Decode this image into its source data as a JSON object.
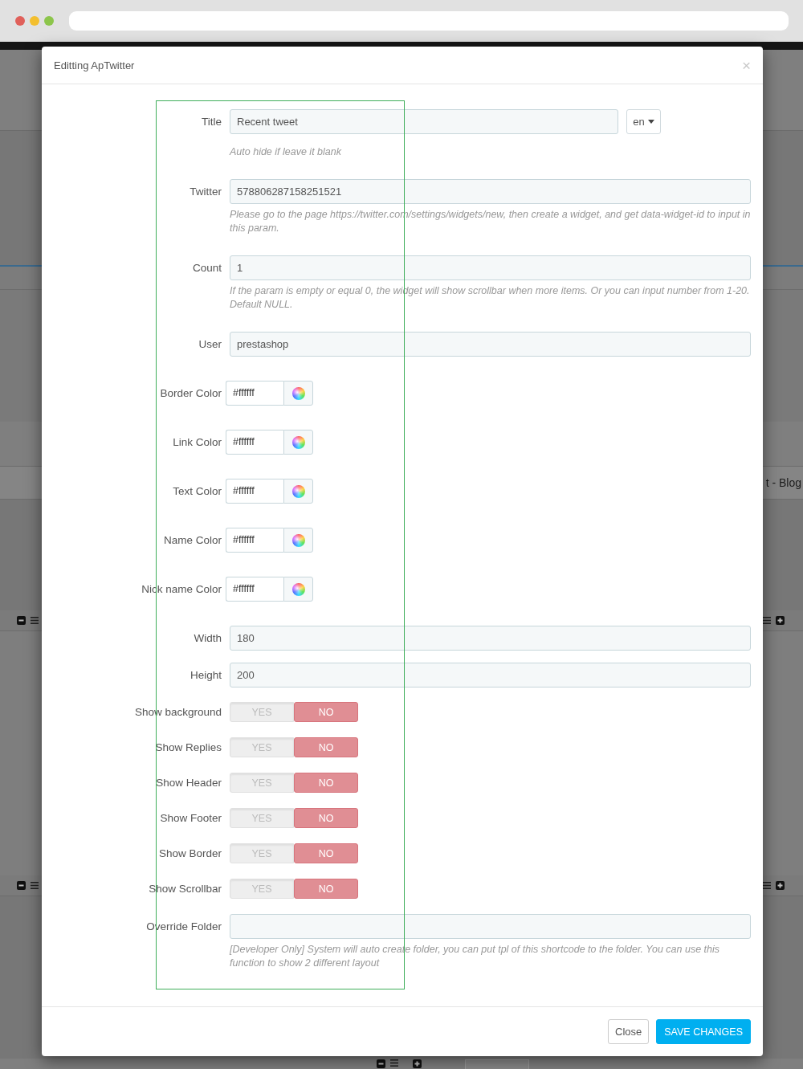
{
  "background_page": {
    "text": "t - Blog"
  },
  "modal": {
    "title": "Editting ApTwitter",
    "close": "×",
    "fields": [
      {
        "kind": "text",
        "label": "Title",
        "value": "Recent tweet",
        "language": "en",
        "help": "Auto hide if leave it blank"
      },
      {
        "kind": "text",
        "label": "Twitter",
        "value": "578806287158251521",
        "help": "Please go to the page https://twitter.com/settings/widgets/new, then create a widget, and get data-widget-id to input in this param."
      },
      {
        "kind": "text",
        "label": "Count",
        "value": "1",
        "help": "If the param is empty or equal 0, the widget will show scrollbar when more items. Or you can input number from 1-20. Default NULL."
      },
      {
        "kind": "text",
        "label": "User",
        "value": "prestashop"
      },
      {
        "kind": "color",
        "label": "Border Color",
        "value": "#ffffff"
      },
      {
        "kind": "color",
        "label": "Link Color",
        "value": "#ffffff"
      },
      {
        "kind": "color",
        "label": "Text Color",
        "value": "#ffffff"
      },
      {
        "kind": "color",
        "label": "Name Color",
        "value": "#ffffff"
      },
      {
        "kind": "color",
        "label": "Nick name Color",
        "value": "#ffffff"
      },
      {
        "kind": "text",
        "label": "Width",
        "value": "180"
      },
      {
        "kind": "text",
        "label": "Height",
        "value": "200"
      },
      {
        "kind": "toggle",
        "label": "Show background",
        "options": [
          {
            "label": "YES",
            "selected": false
          },
          {
            "label": "NO",
            "selected": true
          }
        ]
      },
      {
        "kind": "toggle",
        "label": "Show Replies",
        "options": [
          {
            "label": "YES",
            "selected": false
          },
          {
            "label": "NO",
            "selected": true
          }
        ]
      },
      {
        "kind": "toggle",
        "label": "Show Header",
        "options": [
          {
            "label": "YES",
            "selected": false
          },
          {
            "label": "NO",
            "selected": true
          }
        ]
      },
      {
        "kind": "toggle",
        "label": "Show Footer",
        "options": [
          {
            "label": "YES",
            "selected": false
          },
          {
            "label": "NO",
            "selected": true
          }
        ]
      },
      {
        "kind": "toggle",
        "label": "Show Border",
        "options": [
          {
            "label": "YES",
            "selected": false
          },
          {
            "label": "NO",
            "selected": true
          }
        ]
      },
      {
        "kind": "toggle",
        "label": "Show Scrollbar",
        "options": [
          {
            "label": "YES",
            "selected": false
          },
          {
            "label": "NO",
            "selected": true
          }
        ]
      },
      {
        "kind": "text",
        "label": "Override Folder",
        "help": "[Developer Only] System will auto create folder, you can put tpl of this shortcode to the folder. You can use this function to show 2 different layout"
      }
    ],
    "buttons": [
      {
        "kind": "default",
        "label": "Close"
      },
      {
        "kind": "primary",
        "label": "SAVE CHANGES"
      }
    ]
  }
}
